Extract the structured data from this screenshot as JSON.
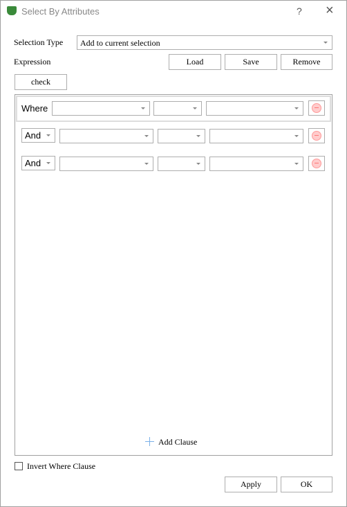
{
  "window": {
    "title": "Select By Attributes",
    "help": "?",
    "close": "×"
  },
  "selection_type": {
    "label": "Selection Type",
    "value": "Add to current selection"
  },
  "expression": {
    "label": "Expression",
    "load": "Load",
    "save": "Save",
    "remove": "Remove",
    "check": "check"
  },
  "clauses": [
    {
      "connector": "Where",
      "field": "",
      "operator": "",
      "value": ""
    },
    {
      "connector": "And",
      "field": "",
      "operator": "",
      "value": ""
    },
    {
      "connector": "And",
      "field": "",
      "operator": "",
      "value": ""
    }
  ],
  "add_clause": "Add Clause",
  "invert": {
    "label": "Invert Where Clause",
    "checked": false
  },
  "footer": {
    "apply": "Apply",
    "ok": "OK"
  }
}
